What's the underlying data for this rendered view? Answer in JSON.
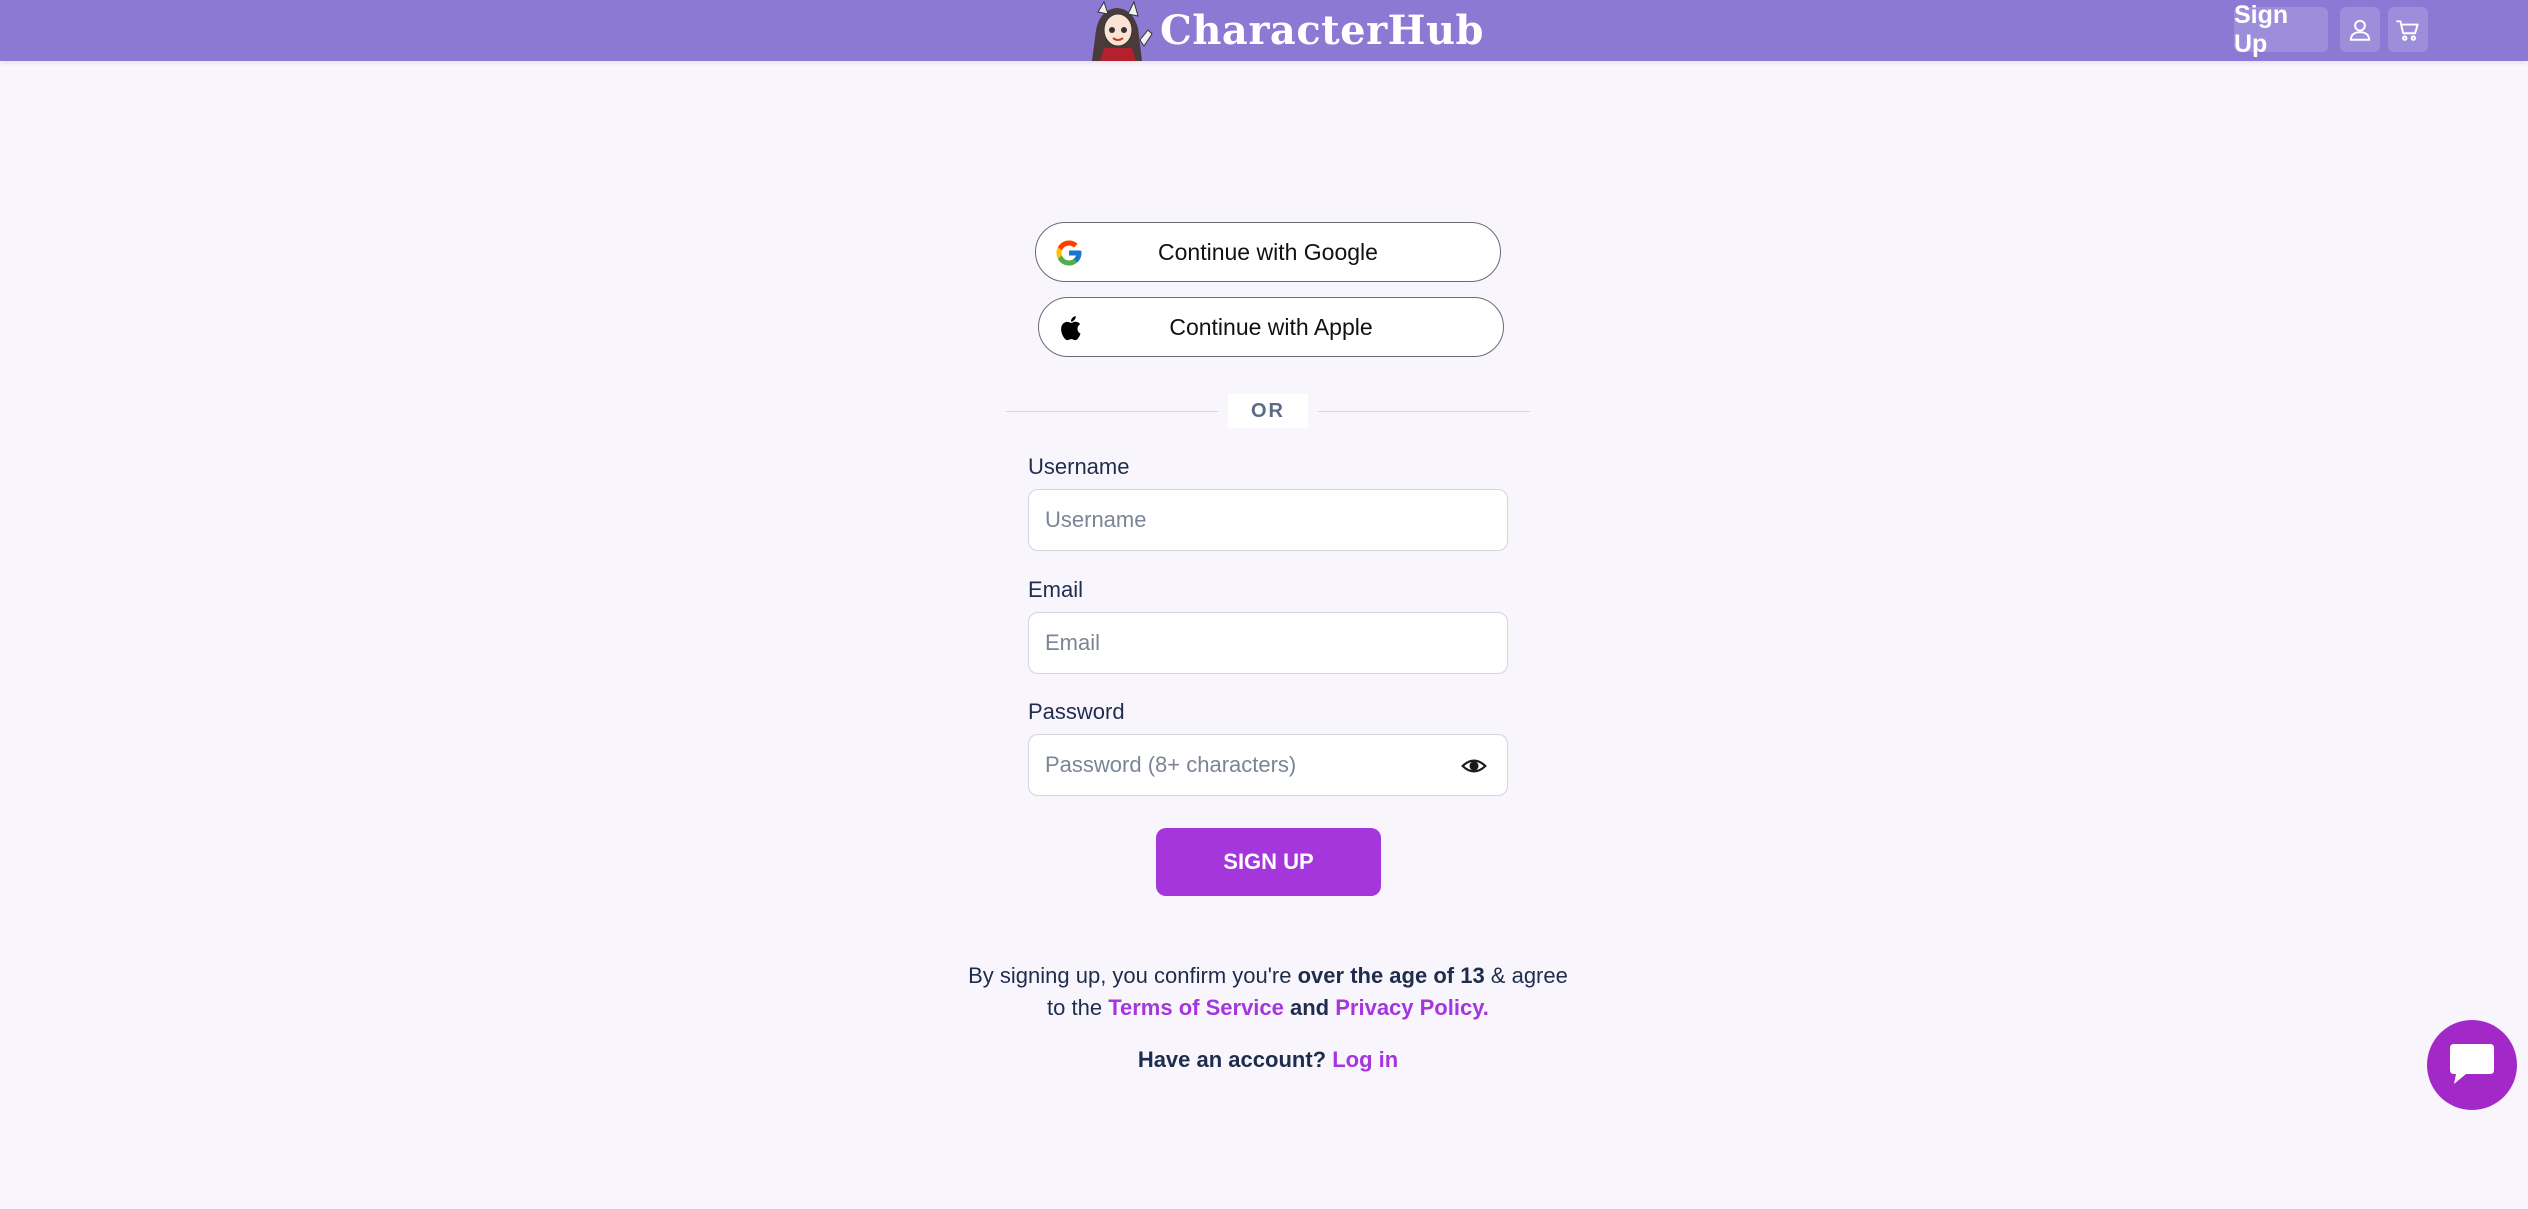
{
  "header": {
    "brand": "CharacterHub",
    "signup_label": "Sign Up",
    "user_icon": "user-icon",
    "cart_icon": "cart-icon"
  },
  "social": {
    "google_label": "Continue with Google",
    "apple_label": "Continue with Apple"
  },
  "divider": {
    "text": "OR"
  },
  "form": {
    "username": {
      "label": "Username",
      "placeholder": "Username",
      "value": ""
    },
    "email": {
      "label": "Email",
      "placeholder": "Email",
      "value": ""
    },
    "password": {
      "label": "Password",
      "placeholder": "Password (8+ characters)",
      "value": ""
    },
    "submit_label": "SIGN UP"
  },
  "legal": {
    "part1": "By signing up, you confirm you're ",
    "age_text": "over the age of 13",
    "part2": " & agree to the ",
    "terms_link": "Terms of Service",
    "and_text": " and ",
    "privacy_link": "Privacy Policy."
  },
  "account": {
    "question": "Have an account? ",
    "login_link": "Log in"
  },
  "colors": {
    "header_bg": "#8b79d4",
    "accent": "#a536dc",
    "page_bg": "#f8f6fc",
    "text": "#1f2d4d"
  }
}
